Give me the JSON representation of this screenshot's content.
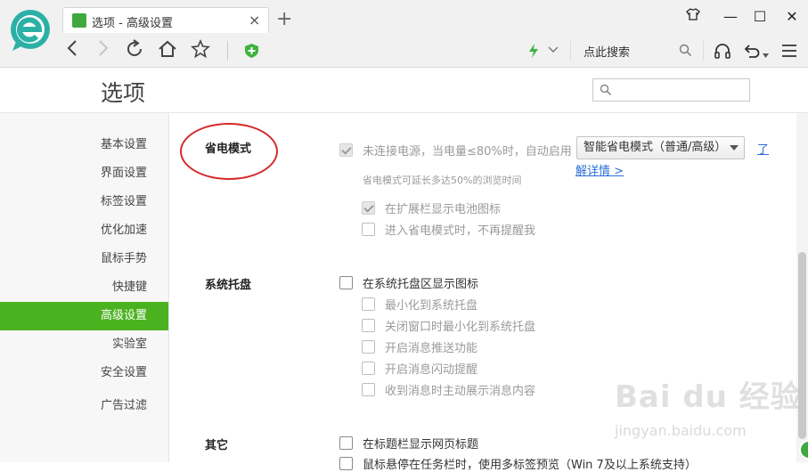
{
  "browser": {
    "tab_title": "选项 - 高级设置",
    "tab_close": "×",
    "new_tab": "+",
    "window_buttons": {
      "skin": "👕",
      "minimize": "—",
      "maximize": "☐",
      "close": "✕"
    },
    "nav": {
      "back": "‹",
      "forward": "›",
      "refresh": "↻",
      "home": "⌂",
      "favorite": "☆"
    },
    "search_label": "点此搜索",
    "accent_color": "#4bb21f"
  },
  "options": {
    "page_title": "选项",
    "search_placeholder": ""
  },
  "sidebar": {
    "items": [
      {
        "label": "基本设置",
        "active": false
      },
      {
        "label": "界面设置",
        "active": false
      },
      {
        "label": "标签设置",
        "active": false
      },
      {
        "label": "优化加速",
        "active": false
      },
      {
        "label": "鼠标手势",
        "active": false
      },
      {
        "label": "快捷键",
        "active": false
      },
      {
        "label": "高级设置",
        "active": true
      },
      {
        "label": "实验室",
        "active": false
      },
      {
        "label": "安全设置",
        "active": false
      },
      {
        "label": "广告过滤",
        "active": false
      }
    ]
  },
  "sections": {
    "power_saving": {
      "title": "省电模式",
      "auto_enable_label": "未连接电源，当电量≤80%时，自动启用",
      "auto_enable_checked": true,
      "mode_select_value": "智能省电模式（普通/高级）",
      "learn_more_1": "了",
      "learn_more_2": "解详情 >",
      "hint": "省电模式可延长多达50%的浏览时间",
      "show_battery_icon_label": "在扩展栏显示电池图标",
      "show_battery_icon_checked": true,
      "no_remind_label": "进入省电模式时，不再提醒我",
      "no_remind_checked": false
    },
    "tray": {
      "title": "系统托盘",
      "show_tray_icon_label": "在系统托盘区显示图标",
      "minimize_to_tray_label": "最小化到系统托盘",
      "close_to_tray_label": "关闭窗口时最小化到系统托盘",
      "push_label": "开启消息推送功能",
      "flash_label": "开启消息闪动提醒",
      "auto_show_label": "收到消息时主动展示消息内容"
    },
    "other": {
      "title": "其它",
      "show_title_label": "在标题栏显示网页标题",
      "cut_off_label": "鼠标悬停在任务栏时，使用多标签预览（Win 7及以上系统支持）"
    }
  },
  "watermark": {
    "text": "Bai du 经验",
    "sub": "jingyan.baidu.com"
  }
}
